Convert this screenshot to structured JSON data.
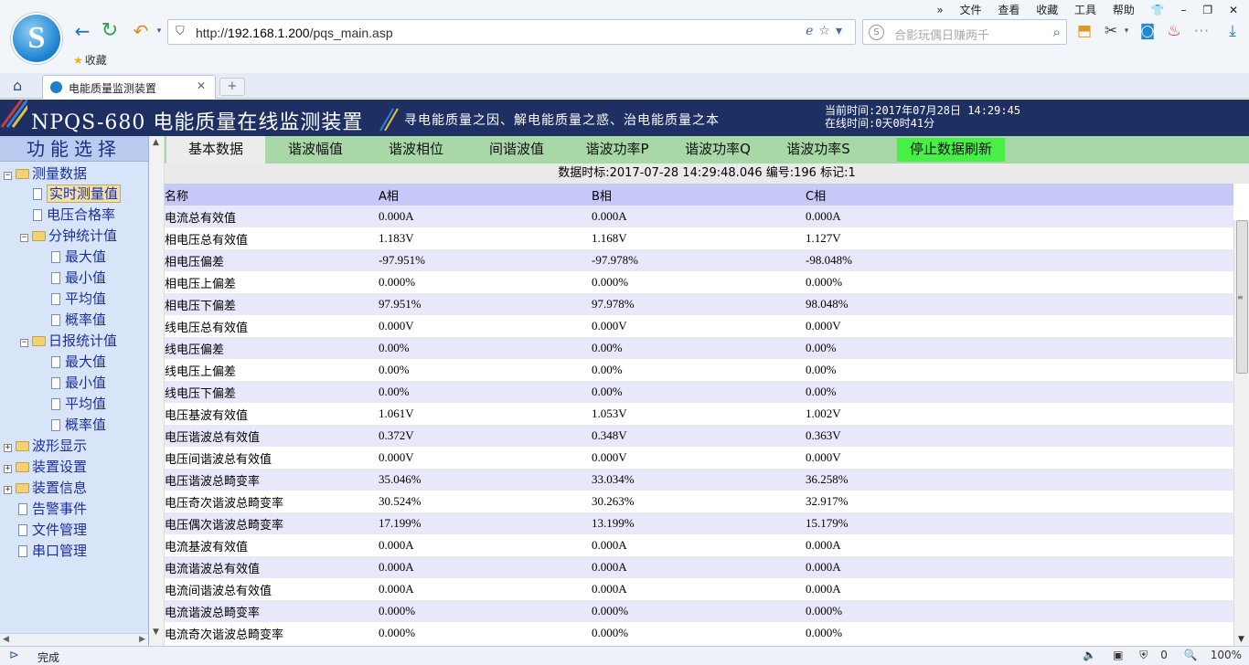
{
  "browser": {
    "menu": [
      "文件",
      "查看",
      "收藏",
      "工具",
      "帮助"
    ],
    "menu_chevrons": "»",
    "url_prefix": "http://",
    "url_host": "192.168.1.200",
    "url_path": "/pqs_main.asp",
    "search_placeholder": "合影玩偶日赚两千",
    "favorites_label": "收藏",
    "tab_title": "电能质量监测装置",
    "new_tab": "+",
    "status_text": "完成",
    "zoom": "100%",
    "downloads_count": "0"
  },
  "header": {
    "title": "NPQS-680  电能质量在线监测装置",
    "slogan": "寻电能质量之因、解电能质量之惑、治电能质量之本",
    "current_time": "当前时间:2017年07月28日  14:29:45",
    "online_time": "在线时间:0天0时41分"
  },
  "sidebar": {
    "title": "功能选择",
    "items": [
      {
        "label": "测量数据"
      },
      {
        "label": "实时测量值"
      },
      {
        "label": "电压合格率"
      },
      {
        "label": "分钟统计值"
      },
      {
        "label": "最大值"
      },
      {
        "label": "最小值"
      },
      {
        "label": "平均值"
      },
      {
        "label": "概率值"
      },
      {
        "label": "日报统计值"
      },
      {
        "label": "最大值"
      },
      {
        "label": "最小值"
      },
      {
        "label": "平均值"
      },
      {
        "label": "概率值"
      },
      {
        "label": "波形显示"
      },
      {
        "label": "装置设置"
      },
      {
        "label": "装置信息"
      },
      {
        "label": "告警事件"
      },
      {
        "label": "文件管理"
      },
      {
        "label": "串口管理"
      }
    ]
  },
  "tabs": [
    "基本数据",
    "谐波幅值",
    "谐波相位",
    "间谐波值",
    "谐波功率P",
    "谐波功率Q",
    "谐波功率S"
  ],
  "stop_button": "停止数据刷新",
  "timestamp_line": "数据时标:2017-07-28 14:29:48.046 编号:196 标记:1",
  "table": {
    "headers": [
      "名称",
      "A相",
      "B相",
      "C相"
    ],
    "rows": [
      [
        "电流总有效值",
        "0.000A",
        "0.000A",
        "0.000A"
      ],
      [
        "相电压总有效值",
        "1.183V",
        "1.168V",
        "1.127V"
      ],
      [
        "相电压偏差",
        "-97.951%",
        "-97.978%",
        "-98.048%"
      ],
      [
        "相电压上偏差",
        "0.000%",
        "0.000%",
        "0.000%"
      ],
      [
        "相电压下偏差",
        "97.951%",
        "97.978%",
        "98.048%"
      ],
      [
        "线电压总有效值",
        "0.000V",
        "0.000V",
        "0.000V"
      ],
      [
        "线电压偏差",
        "0.00%",
        "0.00%",
        "0.00%"
      ],
      [
        "线电压上偏差",
        "0.00%",
        "0.00%",
        "0.00%"
      ],
      [
        "线电压下偏差",
        "0.00%",
        "0.00%",
        "0.00%"
      ],
      [
        "电压基波有效值",
        "1.061V",
        "1.053V",
        "1.002V"
      ],
      [
        "电压谐波总有效值",
        "0.372V",
        "0.348V",
        "0.363V"
      ],
      [
        "电压间谐波总有效值",
        "0.000V",
        "0.000V",
        "0.000V"
      ],
      [
        "电压谐波总畸变率",
        "35.046%",
        "33.034%",
        "36.258%"
      ],
      [
        "电压奇次谐波总畸变率",
        "30.524%",
        "30.263%",
        "32.917%"
      ],
      [
        "电压偶次谐波总畸变率",
        "17.199%",
        "13.199%",
        "15.179%"
      ],
      [
        "电流基波有效值",
        "0.000A",
        "0.000A",
        "0.000A"
      ],
      [
        "电流谐波总有效值",
        "0.000A",
        "0.000A",
        "0.000A"
      ],
      [
        "电流间谐波总有效值",
        "0.000A",
        "0.000A",
        "0.000A"
      ],
      [
        "电流谐波总畸变率",
        "0.000%",
        "0.000%",
        "0.000%"
      ],
      [
        "电流奇次谐波总畸变率",
        "0.000%",
        "0.000%",
        "0.000%"
      ]
    ]
  },
  "colors": {
    "header_bg": "#1e3063",
    "tab_bar": "#a8d8a8",
    "stop_button": "#46f046",
    "row_alt": "#e8e8fb",
    "table_header": "#c8c8f8",
    "sidebar_bg": "#d8e4f8"
  }
}
